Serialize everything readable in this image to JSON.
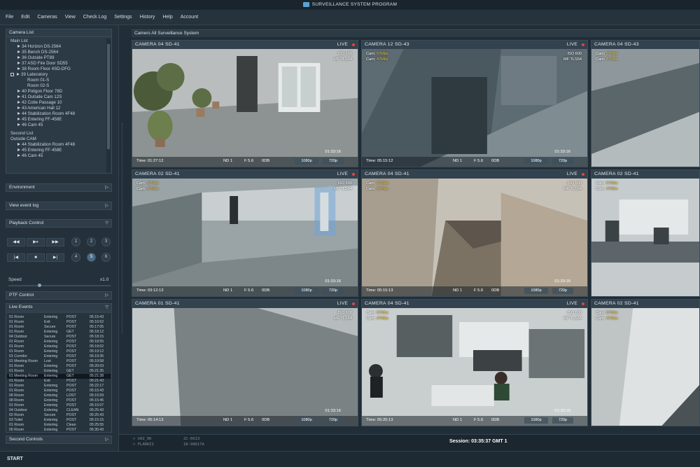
{
  "window": {
    "title": "SURVEILLANCE SYSTEM PROGRAM"
  },
  "menu": [
    "File",
    "Edit",
    "Cameras",
    "View",
    "Check Log",
    "Settings",
    "History",
    "Help",
    "Account"
  ],
  "left": {
    "camera_list_title": "Camera List",
    "tree": [
      "Main List",
      "34 Horizon DS-2564",
      "35 Bench DS-2564",
      "36 Outside PT89",
      "37 ASD Fire Door SD55",
      "38 Room Floor 4SD-DFG",
      "39 Laboratory",
      "Room 01-S",
      "Room 02-S",
      "40 Poligon Floor 78D",
      "41 Outside Cam 12S",
      "42 Cotie Passage 10",
      "43 American Hall 12",
      "44 Stabilization Room 4F48",
      "45 Entering FF-458E",
      "46 Cam 45",
      "Second List",
      "Outside CAM",
      "44 Stabilization Room 4F48",
      "45 Entering FF-458E",
      "46 Cam 45"
    ],
    "environment": "Environment",
    "view_event_log": "View event log",
    "playback_control": "Playback Control",
    "playback_buttons": [
      "◀◀",
      "▶⏸",
      "▶▶",
      "|◀",
      "■",
      "▶|"
    ],
    "numbers": [
      "1",
      "2",
      "3",
      "4",
      "5",
      "6"
    ],
    "speed_label": "Speed",
    "speed_value": "x1.0",
    "speed_fraction": 0.3,
    "ptf_control": "PTF Control",
    "live_events": "Live Events",
    "events": [
      [
        "01 Room",
        "Entering",
        "POST",
        "05:15:43"
      ],
      [
        "01 Room",
        "Exit",
        "POST",
        "05:16:52"
      ],
      [
        "01 Room",
        "Secure",
        "POST",
        "05:17:05"
      ],
      [
        "01 Room",
        "Entering",
        "GET",
        "05:18:12"
      ],
      [
        "04 Outdoor",
        "Secure",
        "POST",
        "05:18:15"
      ],
      [
        "01 Room",
        "Entering",
        "POST",
        "05:18:55"
      ],
      [
        "01 Room",
        "Entering",
        "POST",
        "05:19:02"
      ],
      [
        "01 Room",
        "Entering",
        "POST",
        "05:19:12"
      ],
      [
        "01 Corridor",
        "Entering",
        "POST",
        "05:19:35"
      ],
      [
        "01 Meeting Room",
        "Lost",
        "POST",
        "05:19:58"
      ],
      [
        "01 Room",
        "Entering",
        "POST",
        "05:20:03"
      ],
      [
        "01 Room",
        "Entering",
        "GET",
        "05:21:35"
      ],
      [
        "01 Meeting Room",
        "Entering",
        "GET",
        "05:21:38"
      ],
      [
        "01 Room",
        "Exit",
        "POST",
        "05:21:43"
      ],
      [
        "01 Room",
        "Entering",
        "POST",
        "05:22:17"
      ],
      [
        "01 Room",
        "Entering",
        "POST",
        "05:15:43"
      ],
      [
        "06 Room",
        "Entering",
        "LOST",
        "05:15:59"
      ],
      [
        "08 Room",
        "Entering",
        "POST",
        "05:15:45"
      ],
      [
        "01 Room",
        "Entering",
        "POST",
        "05:15:07"
      ],
      [
        "04 Outdoor",
        "Entering",
        "CLEAN",
        "05:25:43"
      ],
      [
        "02 Room",
        "Secure",
        "POST",
        "05:25:43"
      ],
      [
        "03 Toilet",
        "Entering",
        "POST",
        "05:15:15"
      ],
      [
        "01 Room",
        "Entering",
        "Clean",
        "05:25:55"
      ],
      [
        "05 Room",
        "Entering",
        "POST",
        "05:35:43"
      ]
    ],
    "second_controls": "Second Controls"
  },
  "main": {
    "title": "Camers All Surveillance System",
    "cameras": [
      {
        "name": "CAMERA 04 SD-41",
        "live": "LIVE",
        "cam": "Cam:",
        "cam_rate": "57Mbs",
        "cam2": "Cam:",
        "cam2_rate": "47Mbs",
        "iso": "ISO 600",
        "mf": "MF TLS54",
        "time": "Time: 01:27:12",
        "nd": "ND 1",
        "f": "F 5.6",
        "db": "0DB",
        "res": "1080p",
        "res2": "720p",
        "stamp": "01:33:16"
      },
      {
        "name": "CAMERA 12 SD-43",
        "live": "LIVE",
        "cam": "Cam:",
        "cam_rate": "57Mbs",
        "cam2": "Cam:",
        "cam2_rate": "47Mbs",
        "iso": "ISO 600",
        "mf": "MF TLS54",
        "time": "Time: 05:15:12",
        "nd": "ND 1",
        "f": "F 5.6",
        "db": "0DB",
        "res": "1080p",
        "res2": "720p",
        "stamp": "01:33:16"
      },
      {
        "name": "CAMERA 04 SD-43",
        "live": "LIVE",
        "cam": "Cam:",
        "cam_rate": "57Mbs",
        "cam2": "Cam:",
        "cam2_rate": "47Mbs",
        "iso": "",
        "mf": "",
        "time": "",
        "nd": "",
        "f": "",
        "db": "",
        "res": "",
        "res2": "",
        "stamp": ""
      },
      {
        "name": "CAMERA 02 SD-41",
        "live": "LIVE",
        "cam": "Cam:",
        "cam_rate": "57Mbs",
        "cam2": "Cam:",
        "cam2_rate": "47Mbs",
        "iso": "ISO 600",
        "mf": "MF TLS54",
        "time": "Time: 03:12:13",
        "nd": "ND 1",
        "f": "F 5.6",
        "db": "0DB",
        "res": "1080p",
        "res2": "720p",
        "stamp": "01:33:16"
      },
      {
        "name": "CAMERA 04 SD-41",
        "live": "LIVE",
        "cam": "Cam:",
        "cam_rate": "57Mbs",
        "cam2": "Cam:",
        "cam2_rate": "47Mbs",
        "iso": "ISO 600",
        "mf": "MF TLS54",
        "time": "Time: 05:15:13",
        "nd": "ND 1",
        "f": "F 5.6",
        "db": "0DB",
        "res": "1080p",
        "res2": "720p",
        "stamp": "01:33:16"
      },
      {
        "name": "CAMERA 02 SD-41",
        "live": "LIVE",
        "cam": "Cam:",
        "cam_rate": "57Mbs",
        "cam2": "Cam:",
        "cam2_rate": "47Mbs",
        "iso": "",
        "mf": "",
        "time": "",
        "nd": "",
        "f": "",
        "db": "",
        "res": "",
        "res2": "",
        "stamp": ""
      },
      {
        "name": "CAMERA 01 SD-41",
        "live": "LIVE",
        "cam": "",
        "cam_rate": "",
        "cam2": "",
        "cam2_rate": "",
        "iso": "ISO 600",
        "mf": "MF TLS54",
        "time": "Time: 05:14:13",
        "nd": "ND 1",
        "f": "F 5.6",
        "db": "0DB",
        "res": "1080p",
        "res2": "720p",
        "stamp": "01:33:16"
      },
      {
        "name": "CAMERA 04 SD-41",
        "live": "LIVE",
        "cam": "Cam:",
        "cam_rate": "57Mbs",
        "cam2": "Cam:",
        "cam2_rate": "47Mbs",
        "iso": "ISO 600",
        "mf": "MF TLS54",
        "time": "Time: 05:25:13",
        "nd": "ND 1",
        "f": "F 5.6",
        "db": "0DB",
        "res": "1080p",
        "res2": "720p",
        "stamp": "01:33:16"
      },
      {
        "name": "CAMERA 02 SD-41",
        "live": "LIVE",
        "cam": "Cam:",
        "cam_rate": "57Mbs",
        "cam2": "Cam:",
        "cam2_rate": "47Mbs",
        "iso": "",
        "mf": "",
        "time": "",
        "nd": "",
        "f": "",
        "db": "",
        "res": "",
        "res2": "",
        "stamp": ""
      }
    ]
  },
  "status": {
    "code1": "> VAZ_OK",
    "code1b": "2C-6613",
    "code2": "> FLARKIS",
    "code2b": "18-98817A",
    "session": "Session: 03:35:37 GMT 1"
  },
  "start": "START",
  "colors": {
    "live_dot": "#e04545",
    "accent": "#5aa2d6",
    "rate": "#f0c23a",
    "detection": "#6fb2e8"
  }
}
